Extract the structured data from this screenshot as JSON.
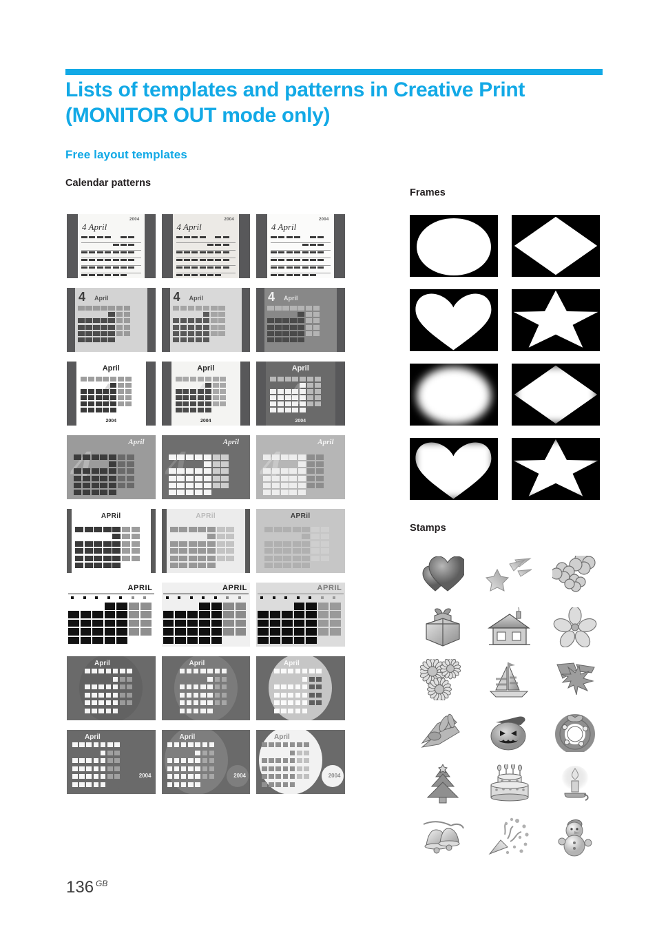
{
  "header": {
    "rule_color": "#12A9E6",
    "title": "Lists of templates and patterns in Creative Print (MONITOR OUT mode only)",
    "subhead": "Free layout templates"
  },
  "sections": {
    "calendar_patterns": {
      "heading": "Calendar patterns",
      "rows": [
        {
          "style": "script-dash",
          "items": [
            {
              "bg": "#58585a",
              "panel": "#f7f7f5",
              "year": "2004",
              "month_script": "4 April",
              "ink": "#3a3a3a"
            },
            {
              "bg": "#58585a",
              "panel": "#eceae6",
              "year": "2004",
              "month_script": "4 April",
              "ink": "#3a3a3a"
            },
            {
              "bg": "#58585a",
              "panel": "#fbfbfa",
              "year": "2004",
              "month_script": "4 April",
              "ink": "#3a3a3a"
            }
          ]
        },
        {
          "style": "big-four",
          "items": [
            {
              "bg": "#58585a",
              "panel": "#d3d3d3",
              "numeral": "4",
              "month": "April",
              "numeral_color": "#3d3d3d",
              "cell": "#4c4c4c",
              "cell_dim": "#9a9a9a"
            },
            {
              "bg": "#58585a",
              "panel": "#d9d9d9",
              "numeral": "4",
              "month": "April",
              "numeral_color": "#3d3d3d",
              "cell": "#595959",
              "cell_dim": "#a5a5a5"
            },
            {
              "bg": "#58585a",
              "panel": "#888888",
              "numeral": "4",
              "month": "April",
              "numeral_color": "#f0f0f0",
              "cell": "#4a4a4a",
              "cell_dim": "#b4b4b4"
            }
          ]
        },
        {
          "style": "april-2004",
          "items": [
            {
              "bg": "#58585a",
              "panel": "#ffffff",
              "month": "April",
              "year": "2004",
              "text_color": "#2b2b2b",
              "cell": "#3a3a3a",
              "cell_dim": "#9e9e9e",
              "watermark": "#d8d8d8"
            },
            {
              "bg": "#58585a",
              "panel": "#f4f4f2",
              "month": "April",
              "year": "2004",
              "text_color": "#2b2b2b",
              "cell": "#4a4a4a",
              "cell_dim": "#a8a8a8",
              "watermark": "#e2e2e2"
            },
            {
              "bg": "#58585a",
              "panel": "#6a6a6a",
              "month": "April",
              "year": "2004",
              "text_color": "#efefef",
              "cell": "#f2f2f2",
              "cell_dim": "#b9b9b9",
              "watermark": "#8a8a8a"
            }
          ]
        },
        {
          "style": "script-april",
          "items": [
            {
              "bg": "#9b9b9b",
              "panel": "#9b9b9b",
              "month_script": "April",
              "text_color": "#f2f2f2",
              "cell": "#3c3c3c",
              "cell_dim": "#6a6a6a",
              "watermark": "#b5b5b5"
            },
            {
              "bg": "#6e6e6e",
              "panel": "#6e6e6e",
              "month_script": "April",
              "text_color": "#efefef",
              "cell": "#f4f4f4",
              "cell_dim": "#cdcdcd",
              "watermark": "#858585"
            },
            {
              "bg": "#b6b6b6",
              "panel": "#b6b6b6",
              "month_script": "April",
              "text_color": "#f6f6f6",
              "cell": "#ededed",
              "cell_dim": "#8d8d8d",
              "watermark": "#c8c8c8"
            }
          ]
        },
        {
          "style": "aprii",
          "items": [
            {
              "bg": "#5a5a5a",
              "panel": "#ffffff",
              "month": "APRil",
              "text_color": "#2b2b2b",
              "cell": "#3a3a3a",
              "cell_dim": "#9d9d9d"
            },
            {
              "bg": "#5a5a5a",
              "panel": "#ececec",
              "month": "APRil",
              "text_color": "#b9b9b9",
              "cell": "#989898",
              "cell_dim": "#c3c3c3"
            },
            {
              "bg": "#c6c6c6",
              "panel": "#c6c6c6",
              "month": "APRil",
              "text_color": "#3a3a3a",
              "cell": "#b0b0b0",
              "cell_dim": "#cfcfcf"
            }
          ]
        },
        {
          "style": "april-caps",
          "items": [
            {
              "bg": "#ffffff",
              "panel": "#ffffff",
              "month": "APRIL",
              "text_color": "#1a1a1a",
              "cell": "#121212",
              "cell_dim": "#8f8f8f"
            },
            {
              "bg": "#f0f0f0",
              "panel": "#f0f0f0",
              "month": "APRIL",
              "text_color": "#1a1a1a",
              "cell": "#101010",
              "cell_dim": "#8b8b8b"
            },
            {
              "bg": "#dcdcdc",
              "panel": "#dcdcdc",
              "month": "APRIL",
              "text_color": "#7a7a7a",
              "cell": "#0f0f0f",
              "cell_dim": "#9a9a9a"
            }
          ]
        },
        {
          "style": "circle-april",
          "items": [
            {
              "bg": "#6a6a6a",
              "circle": "#626262",
              "month": "April",
              "text_color": "#f0f0f0",
              "cell": "#f4f4f4",
              "cell_dim": "#9a9a9a"
            },
            {
              "bg": "#6a6a6a",
              "circle": "#7b7b7b",
              "month": "April",
              "text_color": "#f0f0f0",
              "cell": "#f4f4f4",
              "cell_dim": "#a6a6a6"
            },
            {
              "bg": "#6a6a6a",
              "circle": "#c6c6c6",
              "month": "April",
              "text_color": "#f8f8f8",
              "cell": "#fafafa",
              "cell_dim": "#5f5f5f"
            }
          ]
        },
        {
          "style": "circle-2004",
          "items": [
            {
              "bg": "#6a6a6a",
              "circle": "#6a6a6a",
              "month": "April",
              "year": "2004",
              "text_color": "#f0f0f0",
              "cell": "#f6f6f6",
              "cell_dim": "#a0a0a0"
            },
            {
              "bg": "#6a6a6a",
              "circle": "#7e7e7e",
              "month": "April",
              "year": "2004",
              "text_color": "#f0f0f0",
              "cell": "#f6f6f6",
              "cell_dim": "#a8a8a8"
            },
            {
              "bg": "#6a6a6a",
              "circle": "#f2f2f2",
              "month": "April",
              "year": "2004",
              "text_color": "#8a8a8a",
              "cell": "#909090",
              "cell_dim": "#c0c0c0"
            }
          ]
        }
      ]
    },
    "frames": {
      "heading": "Frames",
      "items": [
        {
          "shape": "ellipse",
          "edge": "hard"
        },
        {
          "shape": "diamond",
          "edge": "hard"
        },
        {
          "shape": "heart",
          "edge": "hard"
        },
        {
          "shape": "star",
          "edge": "hard"
        },
        {
          "shape": "ellipse",
          "edge": "soft"
        },
        {
          "shape": "diamond",
          "edge": "soft"
        },
        {
          "shape": "heart",
          "edge": "soft"
        },
        {
          "shape": "star",
          "edge": "soft"
        }
      ]
    },
    "stamps": {
      "heading": "Stamps",
      "items": [
        "hearts-stamp",
        "shooting-star-stamp",
        "clover-flowers-stamp",
        "gift-box-stamp",
        "house-stamp",
        "cherry-blossom-stamp",
        "sunflowers-stamp",
        "sailboat-stamp",
        "maple-leaves-stamp",
        "dragonfly-leaves-stamp",
        "jack-o-lantern-stamp",
        "christmas-wreath-stamp",
        "christmas-tree-stamp",
        "birthday-cake-stamp",
        "candle-stamp",
        "bells-stamp",
        "party-popper-stamp",
        "snowman-stamp"
      ]
    }
  },
  "footer": {
    "page_number": "136",
    "page_suffix": "GB"
  }
}
